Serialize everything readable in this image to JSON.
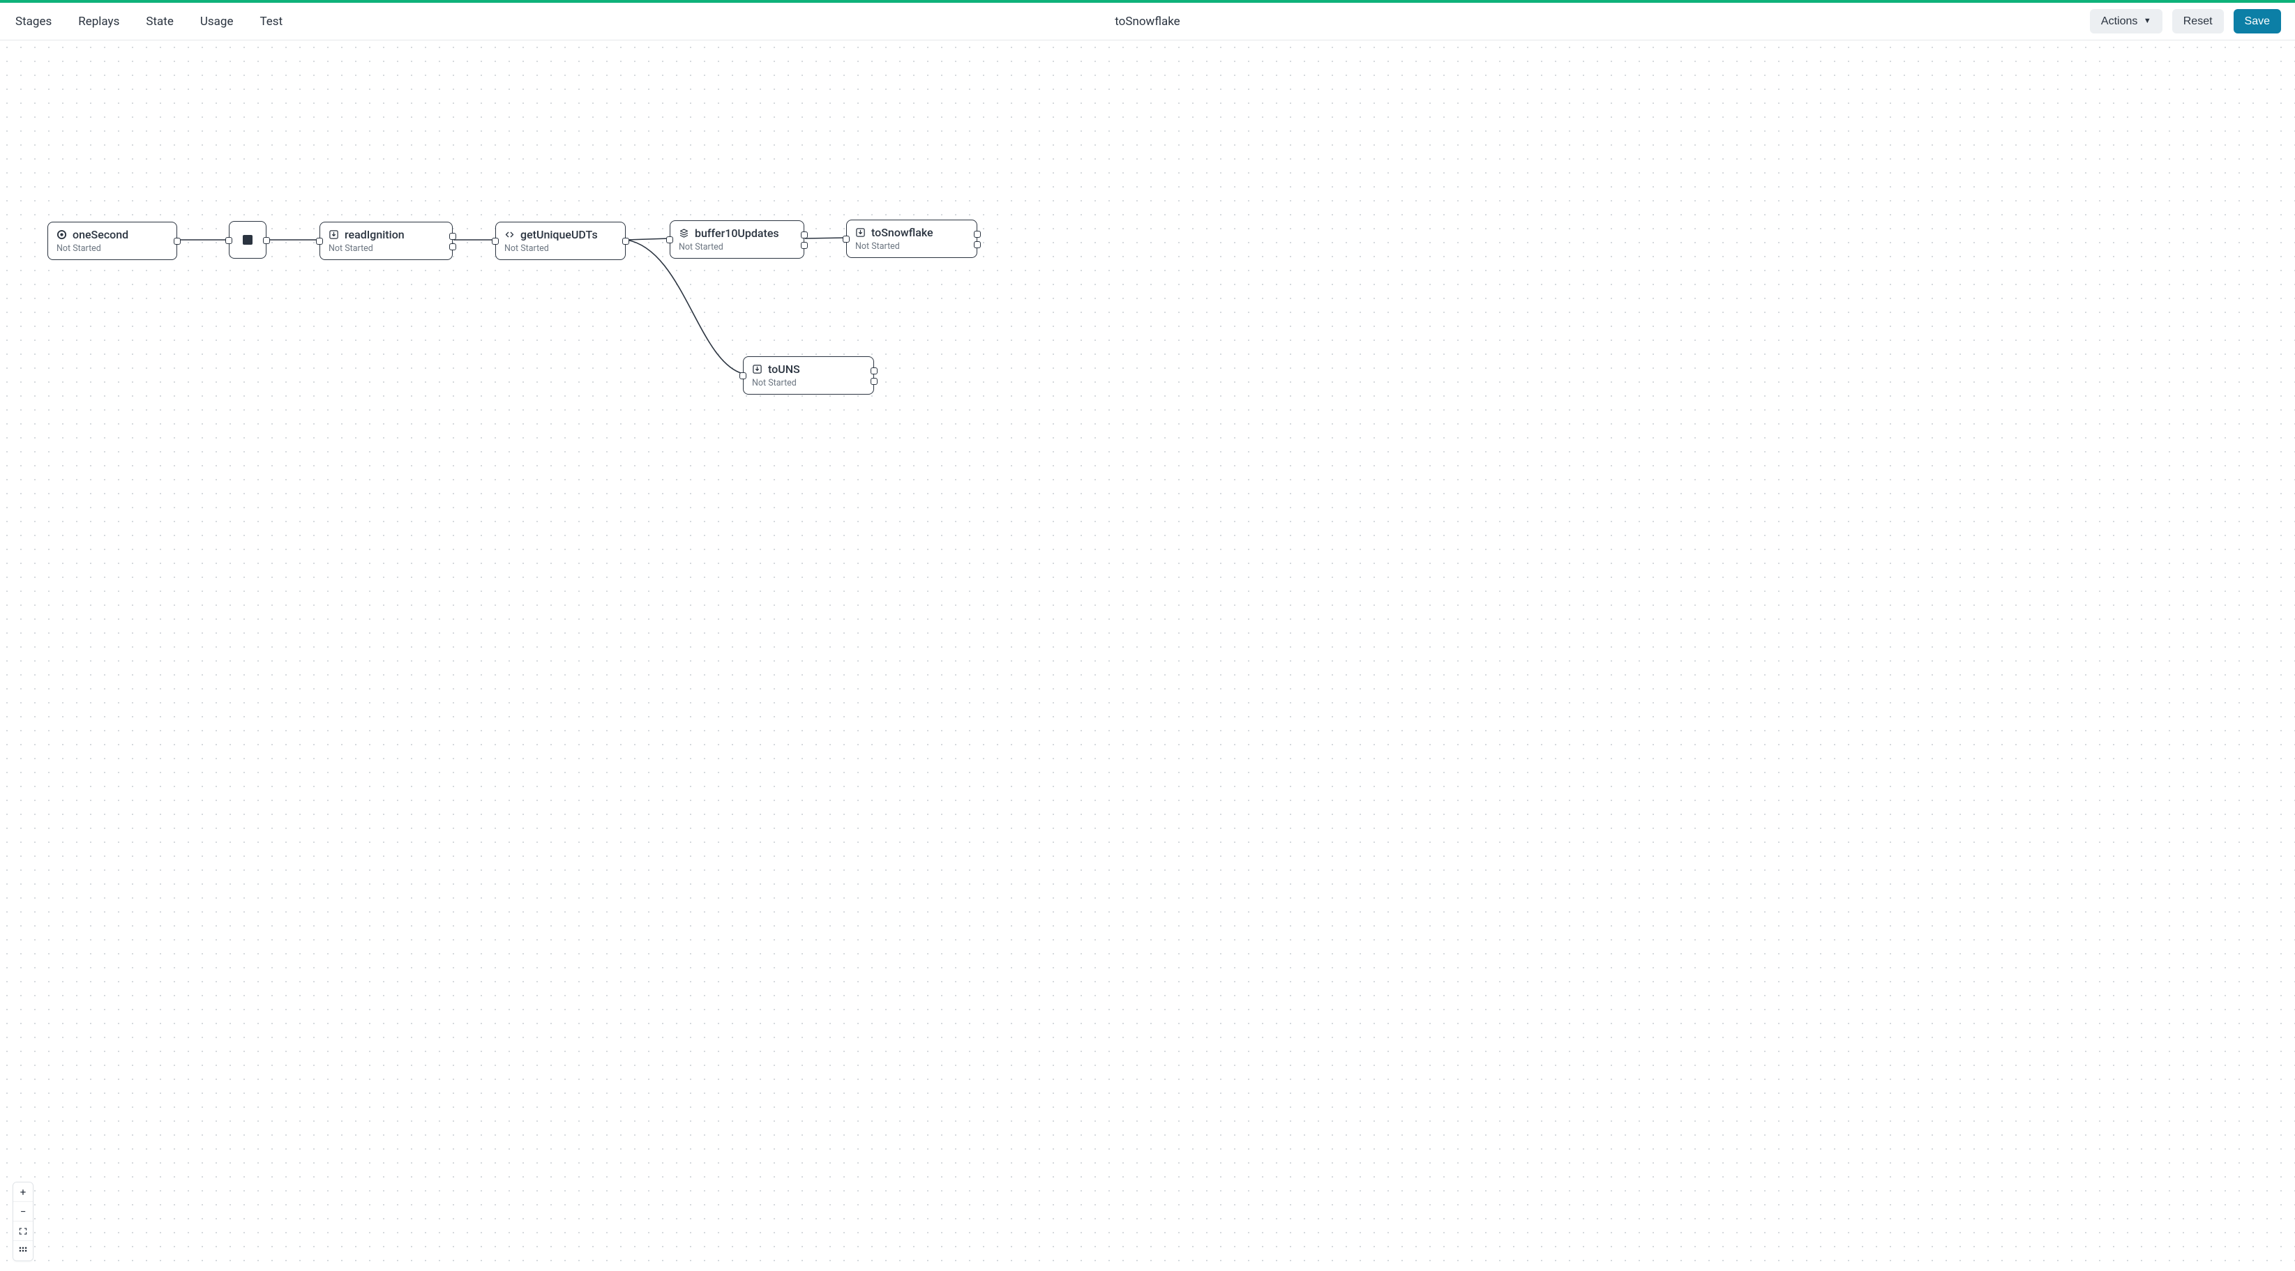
{
  "header": {
    "tabs": [
      "Stages",
      "Replays",
      "State",
      "Usage",
      "Test"
    ],
    "title": "toSnowflake",
    "actions_label": "Actions",
    "reset_label": "Reset",
    "save_label": "Save"
  },
  "nodes": {
    "oneSecond": {
      "label": "oneSecond",
      "status": "Not Started",
      "icon": "circle-dot-icon"
    },
    "stop": {
      "label": "",
      "status": "",
      "icon": "stop-square-icon"
    },
    "readIgnition": {
      "label": "readIgnition",
      "status": "Not Started",
      "icon": "download-box-icon"
    },
    "getUniqueUDTs": {
      "label": "getUniqueUDTs",
      "status": "Not Started",
      "icon": "code-icon"
    },
    "buffer10Updates": {
      "label": "buffer10Updates",
      "status": "Not Started",
      "icon": "stack-icon"
    },
    "toSnowflake": {
      "label": "toSnowflake",
      "status": "Not Started",
      "icon": "download-box-icon"
    },
    "toUNS": {
      "label": "toUNS",
      "status": "Not Started",
      "icon": "download-box-icon"
    }
  },
  "edges": [
    {
      "from": "oneSecond",
      "to": "stop"
    },
    {
      "from": "stop",
      "to": "readIgnition"
    },
    {
      "from": "readIgnition",
      "to": "getUniqueUDTs"
    },
    {
      "from": "getUniqueUDTs",
      "to": "buffer10Updates"
    },
    {
      "from": "buffer10Updates",
      "to": "toSnowflake"
    },
    {
      "from": "getUniqueUDTs",
      "to": "toUNS"
    }
  ],
  "zoom": {
    "in": "+",
    "out": "−"
  }
}
